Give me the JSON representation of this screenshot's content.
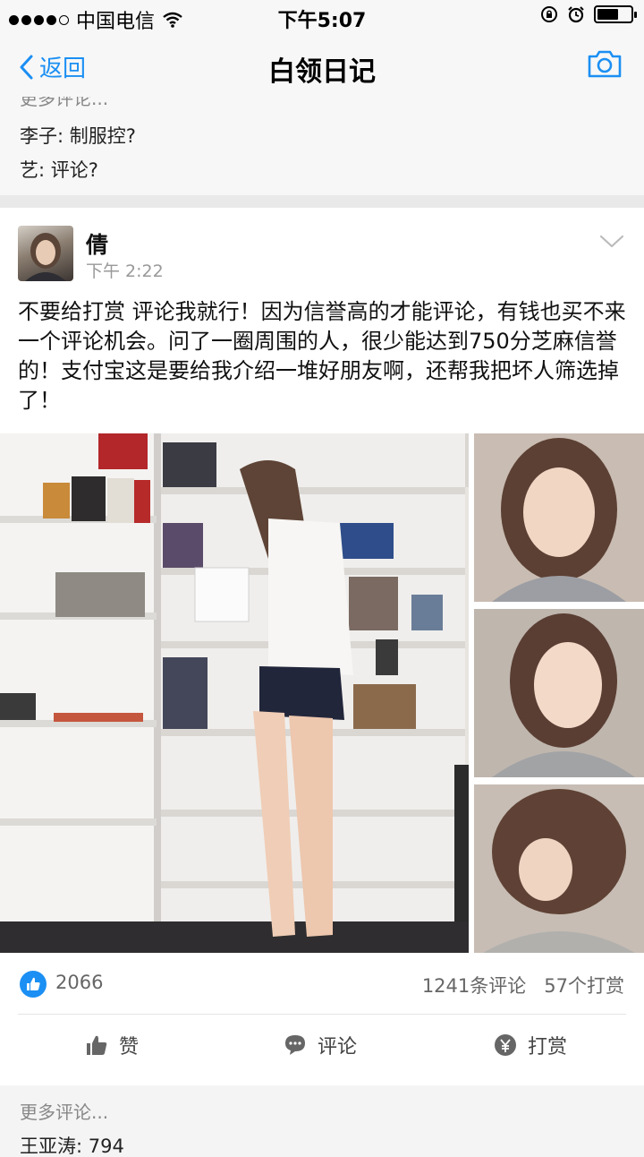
{
  "status_bar": {
    "carrier": "中国电信",
    "time": "下午5:07",
    "battery_level": 0.65
  },
  "nav": {
    "back_label": "返回",
    "title": "白领日记",
    "camera_icon": "camera-icon"
  },
  "prev_card": {
    "more_label": "更多评论...",
    "comments": [
      {
        "author": "李子",
        "text": "制服控?"
      },
      {
        "author": "艺",
        "text": "评论?"
      }
    ]
  },
  "post": {
    "author": "倩",
    "time": "下午 2:22",
    "text": "不要给打赏 评论我就行！因为信誉高的才能评论，有钱也买不来一个评论机会。问了一圈周围的人，很少能达到750分芝麻信誉的！支付宝这是要给我介绍一堆好朋友啊，还帮我把坏人筛选掉了！",
    "likes": "2066",
    "comments_count": "1241条评论",
    "tips_count": "57个打赏"
  },
  "actions": {
    "like": "赞",
    "comment": "评论",
    "tip": "打赏"
  },
  "more_box": {
    "more_label": "更多评论...",
    "first_author": "王亚涛",
    "first_text": "794"
  },
  "colors": {
    "accent": "#1b8ff3",
    "separator": "#e9e9ea"
  }
}
